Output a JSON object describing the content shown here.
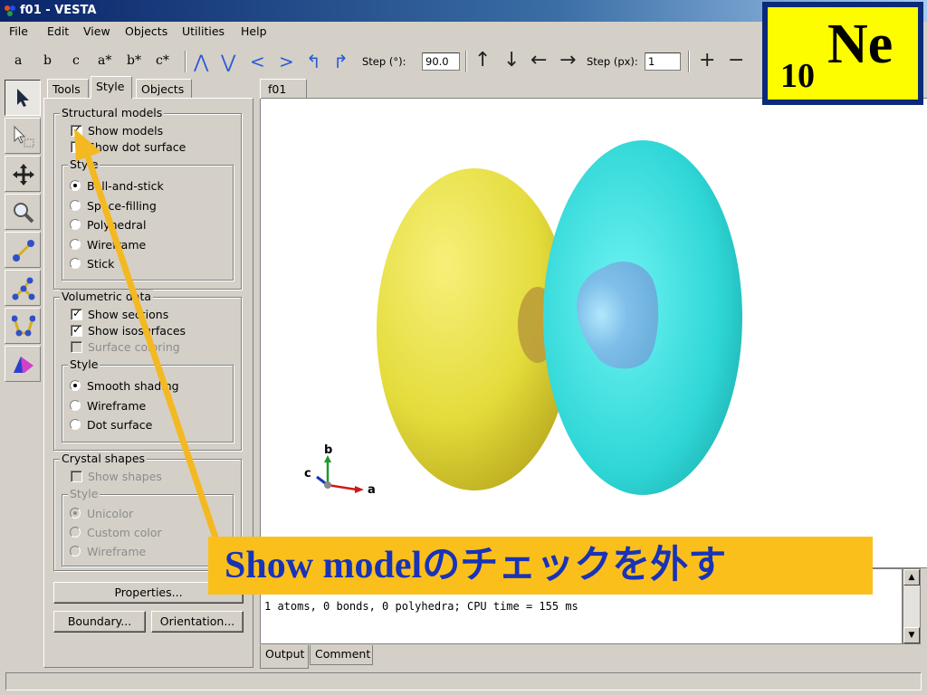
{
  "window": {
    "title": "f01 - VESTA"
  },
  "menu": [
    "File",
    "Edit",
    "View",
    "Objects",
    "Utilities",
    "Help"
  ],
  "toolbar": {
    "axes": [
      "a",
      "b",
      "c",
      "a*",
      "b*",
      "c*"
    ],
    "step_deg_label": "Step (°):",
    "step_deg_value": "90.0",
    "step_px_label": "Step (px):",
    "step_px_value": "1",
    "zoom_in": "+",
    "zoom_out": "−"
  },
  "tabs": [
    "Tools",
    "Style",
    "Objects"
  ],
  "active_tab": "Style",
  "structural_models": {
    "title": "Structural models",
    "show_models": "Show models",
    "show_dot_surface": "Show dot surface",
    "style_title": "Style",
    "styles": [
      "Ball-and-stick",
      "Space-filling",
      "Polyhedral",
      "Wireframe",
      "Stick"
    ]
  },
  "volumetric_data": {
    "title": "Volumetric data",
    "show_sections": "Show sections",
    "show_isosurfaces": "Show isosurfaces",
    "surface_coloring": "Surface coloring",
    "style_title": "Style",
    "styles": [
      "Smooth shading",
      "Wireframe",
      "Dot surface"
    ]
  },
  "crystal_shapes": {
    "title": "Crystal shapes",
    "show_shapes": "Show shapes",
    "style_title": "Style",
    "styles": [
      "Unicolor",
      "Custom color",
      "Wireframe"
    ]
  },
  "buttons": {
    "properties": "Properties...",
    "boundary": "Boundary...",
    "orientation": "Orientation..."
  },
  "viewer": {
    "tab": "f01",
    "axis_labels": [
      "a",
      "b",
      "c"
    ],
    "colors": {
      "lobe_left": "#e4dc3c",
      "lobe_right": "#2fd6d6",
      "inner": "#84b6e8"
    }
  },
  "output": {
    "text": "1 atoms, 0 bonds, 0 polyhedra; CPU time = 155 ms",
    "tabs": [
      "Output",
      "Comment"
    ]
  },
  "badge": {
    "number": "10",
    "symbol": "Ne"
  },
  "callout": {
    "text": "Show modelのチェックを外す"
  }
}
